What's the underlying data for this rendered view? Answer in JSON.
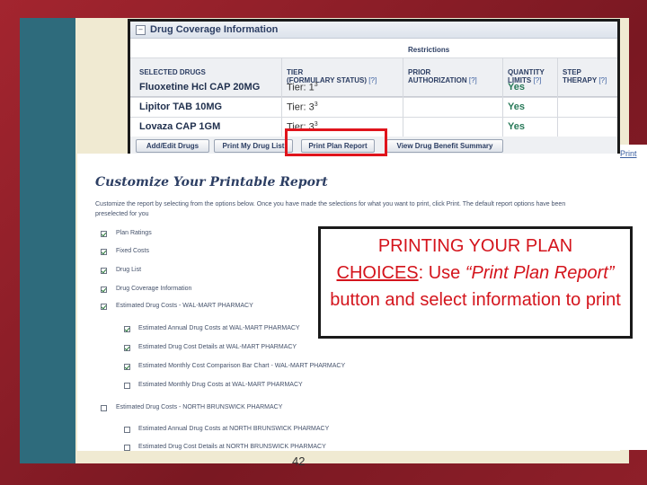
{
  "coverage_panel": {
    "title": "Drug Coverage Information",
    "restrictions_label": "Restrictions",
    "columns": {
      "selected": "SELECTED DRUGS",
      "tier_line1": "TIER",
      "tier_line2": "(FORMULARY STATUS)",
      "prior_line1": "PRIOR",
      "prior_line2": "AUTHORIZATION",
      "qty_line1": "QUANTITY",
      "qty_line2": "LIMITS",
      "step_line1": "STEP",
      "step_line2": "THERAPY",
      "help": "[?]"
    },
    "rows": [
      {
        "drug": "Fluoxetine Hcl CAP 20MG",
        "tier": "Tier: 1",
        "tier_sup": "3",
        "qty": "Yes"
      },
      {
        "drug": "Lipitor TAB 10MG",
        "tier": "Tier: 3",
        "tier_sup": "3",
        "qty": "Yes"
      },
      {
        "drug": "Lovaza CAP 1GM",
        "tier": "Tier: 3",
        "tier_sup": "3",
        "qty": "Yes"
      }
    ],
    "buttons": {
      "add_edit": "Add/Edit Drugs",
      "print_list": "Print My Drug List",
      "print_plan": "Print Plan Report",
      "view_summary": "View Drug Benefit Summary"
    }
  },
  "print_link": "Print",
  "customize": {
    "title": "Customize Your Printable Report",
    "description": "Customize the report by selecting from the options below. Once you have made the selections for what you want to print, click Print. The default report options have been preselected for you",
    "options": [
      {
        "label": "Plan Ratings",
        "checked": true
      },
      {
        "label": "Fixed Costs",
        "checked": true
      },
      {
        "label": "Drug List",
        "checked": true
      },
      {
        "label": "Drug Coverage Information",
        "checked": true
      },
      {
        "label": "Estimated Drug Costs - WAL-MART PHARMACY",
        "checked": true
      },
      {
        "label": "Estimated Annual Drug Costs at WAL-MART PHARMACY",
        "checked": true
      },
      {
        "label": "Estimated Drug Cost Details at WAL-MART PHARMACY",
        "checked": true
      },
      {
        "label": "Estimated Monthly Cost Comparison Bar Chart - WAL-MART PHARMACY",
        "checked": true
      },
      {
        "label": "Estimated Monthly Drug Costs at WAL-MART PHARMACY",
        "checked": false
      },
      {
        "label": "Estimated Drug Costs - NORTH BRUNSWICK PHARMACY",
        "checked": false
      },
      {
        "label": "Estimated Annual Drug Costs at NORTH BRUNSWICK PHARMACY",
        "checked": false
      },
      {
        "label": "Estimated Drug Cost Details at NORTH BRUNSWICK PHARMACY",
        "checked": false
      }
    ]
  },
  "callout": {
    "line1": "PRINTING YOUR PLAN",
    "underlined": "CHOICES",
    "after_underline": ":  Use ",
    "italic": "“Print Plan Report”",
    "rest": " button and select information to print"
  },
  "page_number": "42",
  "colors": {
    "frame_red": "#8c1e2a",
    "teal": "#2e6b7c",
    "highlight_red": "#e0141c",
    "callout_text": "#d4141c"
  }
}
